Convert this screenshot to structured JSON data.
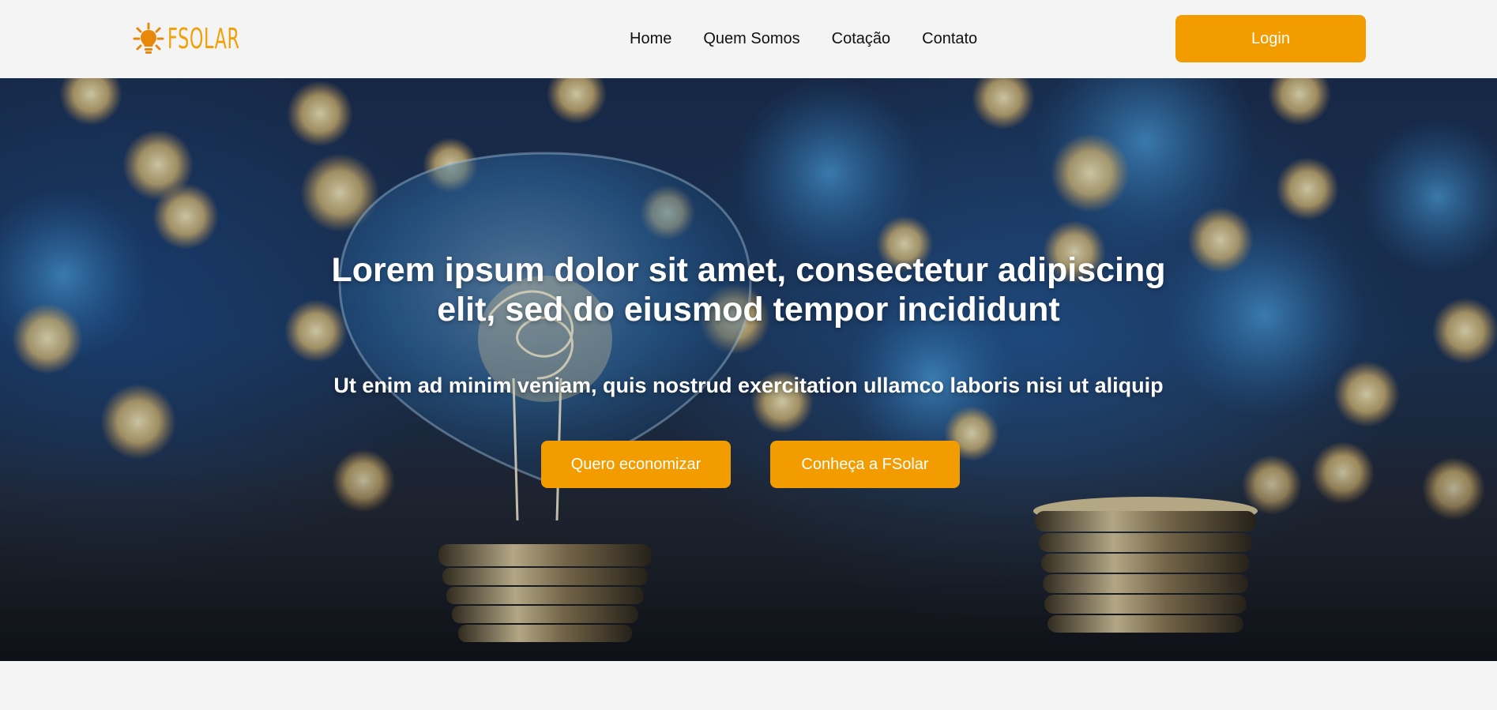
{
  "brand": {
    "name": "FSOLAR",
    "color": "#f2a007",
    "icon": "sun-bulb-icon"
  },
  "nav": {
    "items": [
      {
        "label": "Home"
      },
      {
        "label": "Quem Somos"
      },
      {
        "label": "Cotação"
      },
      {
        "label": "Contato"
      }
    ],
    "login_label": "Login"
  },
  "hero": {
    "title": "Lorem ipsum dolor sit amet, consectetur adipiscing elit, sed do eiusmod tempor incididunt",
    "subtitle": "Ut enim ad minim veniam, quis nostrud exercitation ullamco laboris nisi ut aliquip",
    "buttons": [
      {
        "label": "Quero economizar"
      },
      {
        "label": "Conheça a FSolar"
      }
    ],
    "image": "light-bulb-with-coins-bokeh"
  },
  "colors": {
    "accent": "#f29c00",
    "header_bg": "#f4f4f4",
    "text": "#111111"
  }
}
